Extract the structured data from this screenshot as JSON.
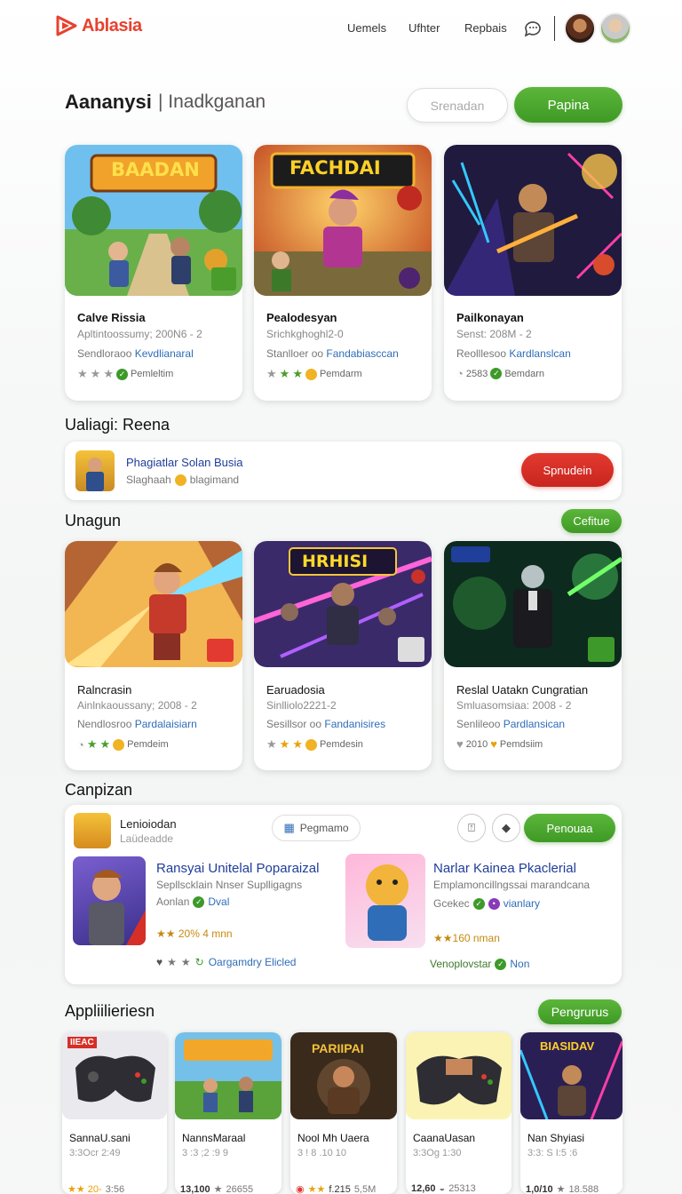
{
  "header": {
    "logo": "Ablasia",
    "nav": [
      "Uemels",
      "Ufhter",
      "Repbais"
    ]
  },
  "title_row": {
    "title": "Aananysi",
    "subtitle": "| Inadkganan",
    "btn_outline": "Srenadan",
    "btn_primary": "Papina"
  },
  "top_cards": [
    {
      "banner": "BAADAN",
      "title": "Calve Rissia",
      "sub": "Apltintoossumy; 200N6 - 2",
      "link_prefix": "Sendloraoo ",
      "link": "Kevdlianaral",
      "rating": "Pemleltim"
    },
    {
      "banner": "FACHDAI",
      "title": "Pealodesyan",
      "sub": "Srichkghoghl2-0",
      "link_prefix": "Stanlloer oo ",
      "link": "Fandabiasccan",
      "rating": "Pemdarm"
    },
    {
      "banner": "",
      "title": "Pailkonayan",
      "sub": "Senst: 208M - 2",
      "link_prefix": "Reolllesoo ",
      "link": "Kardlanslcan",
      "rating": "2583",
      "rating2": "Bemdarn"
    }
  ],
  "section1": {
    "title": "Ualiagi: Reena"
  },
  "promo": {
    "title": "Phagiatlar Solan Busia",
    "sub": "Slaghaah",
    "sub2": "blagimand",
    "button": "Spnudein"
  },
  "section2": {
    "title": "Unagun",
    "button": "Cefitue"
  },
  "mid_cards": [
    {
      "title": "Ralncrasin",
      "sub": "Ainlnkaoussany; 2008 - 2",
      "link_prefix": "Nendlosroo ",
      "link": "Pardalaisiarn",
      "rating": "Pemdeim"
    },
    {
      "banner": "HRHISI",
      "title": "Earuadosia",
      "sub": "Sinlliolo2221-2",
      "link_prefix": "Sesillsor oo ",
      "link": "Fandanisires",
      "rating": "Pemdesin"
    },
    {
      "title": "Reslal Uatakn Cungratian",
      "sub": "Smluasomsiaa: 2008 - 2",
      "link_prefix": "Senlileoo ",
      "link": "Pardlansican",
      "rating": "2010",
      "rating2": "Pemdsiim"
    }
  ],
  "section3": {
    "title": "Canpizan"
  },
  "panel": {
    "head_title": "Lenioiodan",
    "head_sub": "Laüdeadde",
    "chip": "Pegmamo",
    "button": "Penouaa",
    "item1": {
      "title": "Ransyai Unitelal Poparaizal",
      "sub": "Sepllscklain Nnser Suplligagns",
      "meta": "Aonlan",
      "meta2": "Dval",
      "price": "★★ 20% 4 mnn"
    },
    "item2": {
      "title": "Narlar Kainea Pkaclerial",
      "sub": "Emplamoncillngssai marandcana",
      "meta": "Gcekec",
      "meta2": "vianlary",
      "price": "★★160 nman"
    },
    "foot1": "Oargamdry Elicled",
    "foot2": "Venoplovstar",
    "foot2b": "Non"
  },
  "section4": {
    "title": "Appliilieriesn",
    "button": "Pengrurus"
  },
  "tiles": [
    {
      "badge": "IIEAC",
      "title": "SannaU.sani",
      "sub": "3:3Ocr 2:49",
      "b1": "★★ 20-",
      "b2": "3:56"
    },
    {
      "badge": "",
      "title": "NannsMaraal",
      "sub": "3 :3 ;2 :9 9",
      "b1": "13,100",
      "b2": "26655"
    },
    {
      "badge": "PARIIPAI",
      "title": "Nool Mh Uaera",
      "sub": "3 ! 8 .10 10",
      "b1": "f.215",
      "b2": "5,5M"
    },
    {
      "badge": "",
      "title": "CaanaUasan",
      "sub": "3:3Og 1:30",
      "b1": "12,60",
      "b2": "25313"
    },
    {
      "badge": "BIASIDAV",
      "title": "Nan Shyiasi",
      "sub": "3:3: S I:5 :6",
      "b1": "1,0/10",
      "b2": "18.588"
    }
  ],
  "colors": {
    "green": "#4aa82e",
    "red": "#d62f27",
    "link": "#2f6db8",
    "logo": "#e8412f"
  }
}
